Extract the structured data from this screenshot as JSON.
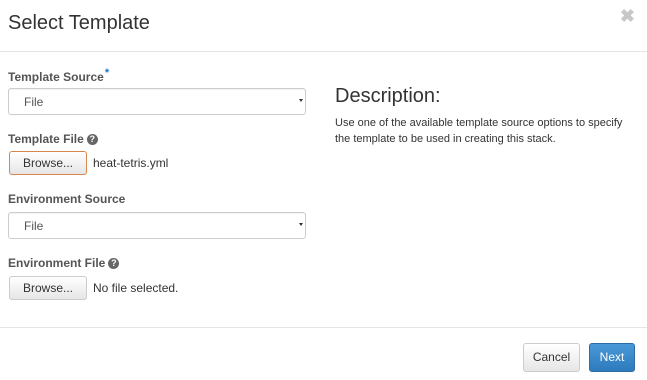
{
  "modal": {
    "title": "Select Template",
    "close_glyph": "✖"
  },
  "form": {
    "template_source": {
      "label": "Template Source",
      "required_mark": "*",
      "value": "File"
    },
    "template_file": {
      "label": "Template File",
      "help_glyph": "?",
      "button_label": "Browse...",
      "filename": "heat-tetris.yml"
    },
    "environment_source": {
      "label": "Environment Source",
      "value": "File"
    },
    "environment_file": {
      "label": "Environment File",
      "help_glyph": "?",
      "button_label": "Browse...",
      "filename": "No file selected."
    }
  },
  "description": {
    "title": "Description:",
    "text": "Use one of the available template source options to specify the template to be used in creating this stack."
  },
  "footer": {
    "cancel_label": "Cancel",
    "next_label": "Next"
  },
  "colors": {
    "primary": "#337ab7",
    "focus_border": "#d9864d",
    "required": "#1a74d0"
  }
}
